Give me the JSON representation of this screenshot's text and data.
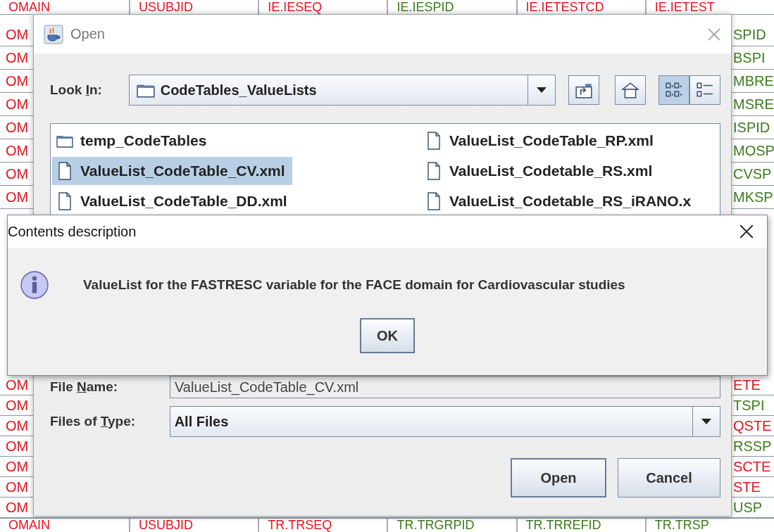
{
  "background_table": {
    "top_row": [
      {
        "text": "OMAIN",
        "color": "#e8141e"
      },
      {
        "text": "USUBJID",
        "color": "#e8141e"
      },
      {
        "text": "IE.IESEQ",
        "color": "#e8141e"
      },
      {
        "text": "IE.IESPID",
        "color": "#3c7d1c"
      },
      {
        "text": "IE.IETESTCD",
        "color": "#e8141e"
      },
      {
        "text": "IE.IETEST",
        "color": "#e8141e"
      }
    ],
    "upper_rows": [
      {
        "left": {
          "text": "OM",
          "color": "#e8141e"
        },
        "right": {
          "text": "SPID",
          "color": "#3c7d1c"
        }
      },
      {
        "left": {
          "text": "OM",
          "color": "#e8141e"
        },
        "right": {
          "text": "BSPI",
          "color": "#3c7d1c"
        }
      },
      {
        "left": {
          "text": "OM",
          "color": "#e8141e"
        },
        "right": {
          "text": "MBRE",
          "color": "#3c7d1c"
        }
      },
      {
        "left": {
          "text": "OM",
          "color": "#e8141e"
        },
        "right": {
          "text": "MSRE",
          "color": "#3c7d1c"
        }
      },
      {
        "left": {
          "text": "OM",
          "color": "#e8141e"
        },
        "right": {
          "text": "ISPID",
          "color": "#3c7d1c"
        }
      },
      {
        "left": {
          "text": "OM",
          "color": "#e8141e"
        },
        "right": {
          "text": "MOSP",
          "color": "#3c7d1c"
        }
      },
      {
        "left": {
          "text": "OM",
          "color": "#e8141e"
        },
        "right": {
          "text": "CVSP",
          "color": "#3c7d1c"
        }
      },
      {
        "left": {
          "text": "OM",
          "color": "#e8141e"
        },
        "right": {
          "text": "MKSP",
          "color": "#3c7d1c"
        }
      }
    ],
    "lower_rows": [
      {
        "left": {
          "text": "OM",
          "color": "#e8141e"
        },
        "right": {
          "text": "ETE",
          "color": "#e8141e"
        }
      },
      {
        "left": {
          "text": "OM",
          "color": "#e8141e"
        },
        "right": {
          "text": "TSPI",
          "color": "#3c7d1c"
        }
      },
      {
        "left": {
          "text": "OM",
          "color": "#e8141e"
        },
        "right": {
          "text": "QSTE",
          "color": "#e8141e"
        }
      },
      {
        "left": {
          "text": "OM",
          "color": "#e8141e"
        },
        "right": {
          "text": "RSSP",
          "color": "#3c7d1c"
        }
      },
      {
        "left": {
          "text": "OM",
          "color": "#e8141e"
        },
        "right": {
          "text": "SCTE",
          "color": "#e8141e"
        }
      },
      {
        "left": {
          "text": "OM",
          "color": "#e8141e"
        },
        "right": {
          "text": "STE",
          "color": "#e8141e"
        }
      },
      {
        "left": {
          "text": "OM",
          "color": "#e8141e"
        },
        "right": {
          "text": "USP",
          "color": "#3c7d1c"
        }
      }
    ],
    "bottom_row": [
      {
        "text": "OMAIN",
        "color": "#e8141e"
      },
      {
        "text": "USUBJID",
        "color": "#e8141e"
      },
      {
        "text": "TR.TRSEQ",
        "color": "#e8141e"
      },
      {
        "text": "TR.TRGRPID",
        "color": "#3c7d1c"
      },
      {
        "text": "TR.TRREFID",
        "color": "#3c7d1c"
      },
      {
        "text": "TR.TRSP",
        "color": "#3c7d1c"
      }
    ]
  },
  "open_dialog": {
    "title": "Open",
    "look_in": {
      "label_parts": [
        "Look ",
        "I",
        "n:"
      ],
      "value": "CodeTables_ValueLists"
    },
    "tools": [
      {
        "kind": "up",
        "selected": false
      },
      {
        "kind": "home",
        "selected": false
      },
      {
        "kind": "list",
        "selected": true
      },
      {
        "kind": "details",
        "selected": false
      }
    ],
    "files": [
      {
        "name": "temp_CodeTables",
        "kind": "folder",
        "selected": false
      },
      {
        "name": "ValueList_CodeTable_CV.xml",
        "kind": "file",
        "selected": true
      },
      {
        "name": "ValueList_CodeTable_DD.xml",
        "kind": "file",
        "selected": false
      },
      {
        "name": "ValueList_CodeTable_RP.xml",
        "kind": "file",
        "selected": false
      },
      {
        "name": "ValueList_Codetable_RS.xml",
        "kind": "file",
        "selected": false
      },
      {
        "name": "ValueList_Codetable_RS_iRANO.x",
        "kind": "file",
        "selected": false
      }
    ],
    "file_name": {
      "label_parts": [
        "File ",
        "N",
        "ame:"
      ],
      "value": "ValueList_CodeTable_CV.xml"
    },
    "files_of_type": {
      "label_parts": [
        "Files of ",
        "T",
        "ype:"
      ],
      "value": "All Files"
    },
    "buttons": [
      "Open",
      "Cancel"
    ]
  },
  "message_dialog": {
    "title": "Contents description",
    "message": "ValueList for the FASTRESC variable for the FACE domain for Cardiovascular studies",
    "button": "OK"
  }
}
